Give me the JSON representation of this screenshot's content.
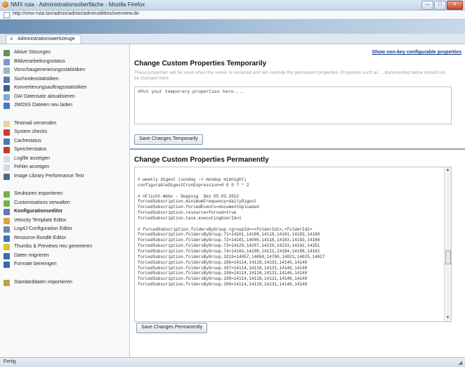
{
  "window": {
    "title": "NMX ruta - Administrationsoberfläche - Mozilla Firefox",
    "buttons": {
      "minimize": "–",
      "maximize": "□",
      "close": "✕"
    }
  },
  "address": {
    "url": "http://nmx-ruta.lan/admin/admin/adminutilities/overview.do"
  },
  "tab": {
    "label": "Administrationswerkzeuge"
  },
  "sidebar": {
    "items": [
      {
        "label": "Aktive Sitzungen",
        "icon": "user-icon",
        "color": "#6a8e4e"
      },
      {
        "label": "Bildverarbeitungsstatus",
        "icon": "image-status-icon",
        "color": "#7a9ac4"
      },
      {
        "label": "Vorschaugenerierungsstatistiken",
        "icon": "preview-icon",
        "color": "#a0b4c8"
      },
      {
        "label": "Suchindexstatistiken",
        "icon": "search-icon",
        "color": "#5a7ab0"
      },
      {
        "label": "Konvertierungsauftragsstatistiken",
        "icon": "convert-icon",
        "color": "#3d5f8c"
      },
      {
        "label": "OAI Datensatz aktualisieren",
        "icon": "oai-icon",
        "color": "#8aa8c8"
      },
      {
        "label": "JMOSS Dateien neu laden",
        "icon": "reload-icon",
        "color": "#3f7fc0"
      },
      {
        "label": "Testmail versenden",
        "icon": "mail-icon",
        "color": "#e8d49a",
        "sep": true
      },
      {
        "label": "System checks",
        "icon": "system-check-icon",
        "color": "#d23a2a"
      },
      {
        "label": "Cachestatus",
        "icon": "cache-icon",
        "color": "#4c7ab0"
      },
      {
        "label": "Speicherstatus",
        "icon": "memory-icon",
        "color": "#c23a28"
      },
      {
        "label": "Logfile anzeigen",
        "icon": "logfile-icon",
        "color": "#d8dce0"
      },
      {
        "label": "Fehler anzeigen",
        "icon": "error-icon",
        "color": "#d8dce0"
      },
      {
        "label": "Image Library Performance Test",
        "icon": "performance-icon",
        "color": "#4a6a8a"
      },
      {
        "label": "Strukturen importieren",
        "icon": "import-structure-icon",
        "color": "#7ab04a",
        "sep": true
      },
      {
        "label": "Customisations verwalten",
        "icon": "customise-icon",
        "color": "#7ab04a"
      },
      {
        "label": "Konfigurationseditor",
        "icon": "config-editor-icon",
        "color": "#5a7ab0",
        "bold": true
      },
      {
        "label": "Velocity Template Editor",
        "icon": "velocity-icon",
        "color": "#e0a040"
      },
      {
        "label": "Log4J Configuration Editor",
        "icon": "log4j-icon",
        "color": "#6a8ab0"
      },
      {
        "label": "Resource Bundle Editor",
        "icon": "resource-bundle-icon",
        "color": "#4070c0"
      },
      {
        "label": "Thumbs & Previews neu generieren",
        "icon": "thumbs-icon",
        "color": "#e0c030"
      },
      {
        "label": "Daten migrieren",
        "icon": "migrate-icon",
        "color": "#3a6ab0"
      },
      {
        "label": "Formate bereinigen",
        "icon": "formats-icon",
        "color": "#3a6ab0"
      },
      {
        "label": "Standarddaten importieren",
        "icon": "standard-data-icon",
        "color": "#c8a040",
        "sep": true
      }
    ]
  },
  "main": {
    "show_link": "Show non-key configurable properties",
    "temp_heading": "Change Custom Properties Temporarily",
    "temp_description": "These properties will be reset when the server is restarted and will override the permanent properties. Properties such as ... documented below should not be changed here.",
    "temp_placeholder": "#Put your temporary properties here....",
    "temp_button": "Save Changes Temporarily",
    "perm_heading": "Change Custom Properties Permanently",
    "perm_lines": [
      "# weekly digest (sunday -> monday midnight)",
      "configurableDigestCronExpression=0 0 0 ? * 2",
      "",
      "# #Flicht-Abbo - Deppisg  Dez 05.03.2012",
      "forcedSubscription.minimumFrequency=dailyDigest",
      "forcedSubscription.forcedEvents=documentUploaded",
      "forcedSubscription.resource=forced=true",
      "forcedSubscription.task.executingUserId=1",
      "",
      "# forcedSubscription.foldersByGroup.<groupId>=<folderId1>,<folderId2>",
      "forcedSubscription.foldersByGroup.71=14101,14108,14118,14181,14183,14188",
      "forcedSubscription.foldersByGroup.72=14101,14000,14118,14183,14183,14188",
      "forcedSubscription.foldersByGroup.73=14120,14207,14220,14233,14242,14251",
      "forcedSubscription.foldersByGroup.74=14184,14108,14121,14184,14188,14182",
      "forcedSubscription.foldersByGroup.3219=14057,14058,14700,14023,14025,14027",
      "forcedSubscription.foldersByGroup.196=14114,14118,14131,14140,14149",
      "forcedSubscription.foldersByGroup.197=14114,14118,14131,14140,14149",
      "forcedSubscription.foldersByGroup.198=14114,14118,14131,14140,14149",
      "forcedSubscription.foldersByGroup.199=14114,14118,14131,14140,14149",
      "forcedSubscription.foldersByGroup.200=14114,14118,14131,14140,14149"
    ],
    "perm_button": "Save Changes Permanently"
  },
  "status": {
    "text": "Fertig",
    "grip": "◢"
  }
}
